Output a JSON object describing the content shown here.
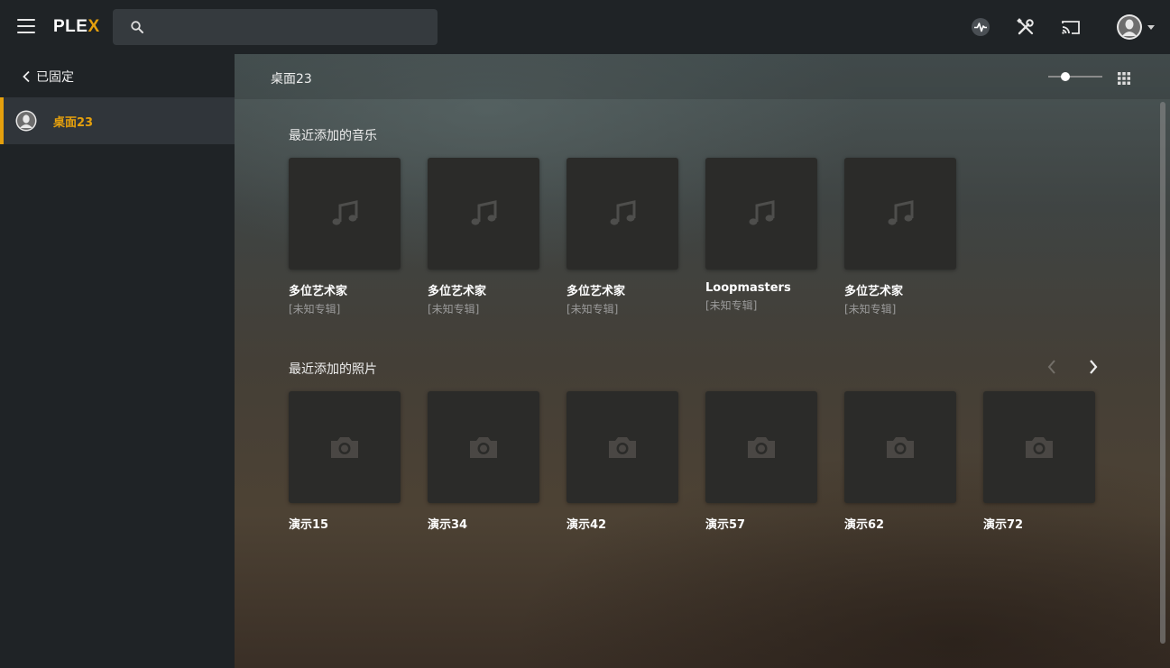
{
  "topbar": {
    "logo_main": "PLE",
    "logo_accent": "X",
    "search_value": "",
    "search_placeholder": ""
  },
  "sidebar": {
    "back_label": "已固定",
    "items": [
      {
        "label": "桌面23"
      }
    ]
  },
  "main": {
    "title": "桌面23",
    "sections": [
      {
        "title": "最近添加的音乐",
        "items": [
          {
            "title": "多位艺术家",
            "subtitle": "[未知专辑]"
          },
          {
            "title": "多位艺术家",
            "subtitle": "[未知专辑]"
          },
          {
            "title": "多位艺术家",
            "subtitle": "[未知专辑]"
          },
          {
            "title": "Loopmasters",
            "subtitle": "[未知专辑]"
          },
          {
            "title": "多位艺术家",
            "subtitle": "[未知专辑]"
          }
        ]
      },
      {
        "title": "最近添加的照片",
        "items": [
          {
            "title": "演示15"
          },
          {
            "title": "演示34"
          },
          {
            "title": "演示42"
          },
          {
            "title": "演示57"
          },
          {
            "title": "演示62"
          },
          {
            "title": "演示72"
          }
        ]
      }
    ]
  },
  "icons": {
    "menu": "hamburger-icon",
    "search": "search-icon",
    "activity": "activity-icon",
    "settings": "wrench-screwdriver-icon",
    "cast": "cast-icon",
    "user": "user-avatar-icon",
    "music": "music-note-icon",
    "photo": "camera-icon"
  },
  "colors": {
    "accent": "#e5a00d",
    "topbar": "#1f2326",
    "sidebar_active": "#30353a"
  }
}
